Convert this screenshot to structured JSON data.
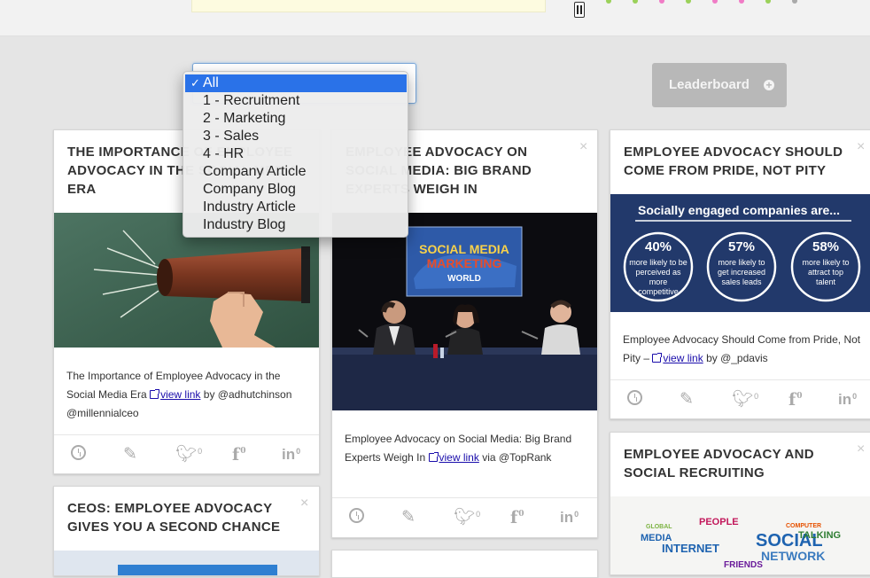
{
  "filter": {
    "options": [
      {
        "label": "All",
        "selected": true
      },
      {
        "label": "1 - Recruitment",
        "selected": false
      },
      {
        "label": "2 - Marketing",
        "selected": false
      },
      {
        "label": "3 - Sales",
        "selected": false
      },
      {
        "label": "4 - HR",
        "selected": false
      },
      {
        "label": "Company Article",
        "selected": false
      },
      {
        "label": "Company Blog",
        "selected": false
      },
      {
        "label": "Industry Article",
        "selected": false
      },
      {
        "label": "Industry Blog",
        "selected": false
      }
    ],
    "check": "✓"
  },
  "leaderboard": {
    "label": "Leaderboard",
    "icon": "plus-circle-icon"
  },
  "cards": {
    "c1": {
      "title": "THE IMPORTANCE OF EMPLOYEE ADVOCACY IN THE SOCIAL MEDIA ERA",
      "body": "The Importance of Employee Advocacy in the Social Media Era",
      "link": "view link",
      "by_text": "by",
      "handles": "@adhutchinson @millennialceo",
      "image": "megaphone-photo"
    },
    "c2": {
      "title": "EMPLOYEE ADVOCACY ON SOCIAL MEDIA: BIG BRAND EXPERTS WEIGH IN",
      "body": "Employee Advocacy on Social Media: Big Brand Experts Weigh In",
      "link": "view link",
      "via": "via",
      "handle": "@TopRank",
      "image": "panel-photo",
      "banner": [
        "SOCIAL MEDIA",
        "MARKETING",
        "WORLD"
      ]
    },
    "c3": {
      "title": "EMPLOYEE ADVOCACY SHOULD COME FROM PRIDE, NOT PITY",
      "body": "Employee Advocacy Should Come from Pride, Not Pity –",
      "link": "view link",
      "by": "by @_pdavis",
      "infographic": {
        "heading": "Socially engaged companies are...",
        "stats": [
          {
            "value": "40%",
            "text": "more likely to be perceived as more competitive"
          },
          {
            "value": "57%",
            "text": "more likely to get increased sales leads"
          },
          {
            "value": "58%",
            "text": "more likely to attract top talent"
          }
        ]
      }
    },
    "c4": {
      "title": "CEOS: EMPLOYEE ADVOCACY GIVES YOU A SECOND CHANCE"
    },
    "c5": {
      "title": "EMPLOYEE ADVOCACY AND SOCIAL RECRUITING",
      "cloud": [
        "PEOPLE",
        "MEDIA",
        "SOCIAL",
        "TALKING",
        "INTERNET",
        "NETWORK",
        "GLOBAL",
        "COMPUTER",
        "FRIENDS"
      ]
    },
    "close": "×"
  },
  "footer": {
    "count": "0"
  },
  "colors": {
    "accent": "#2a72e8",
    "infographic_bg": "#22396b",
    "link": "#1a0dab"
  }
}
